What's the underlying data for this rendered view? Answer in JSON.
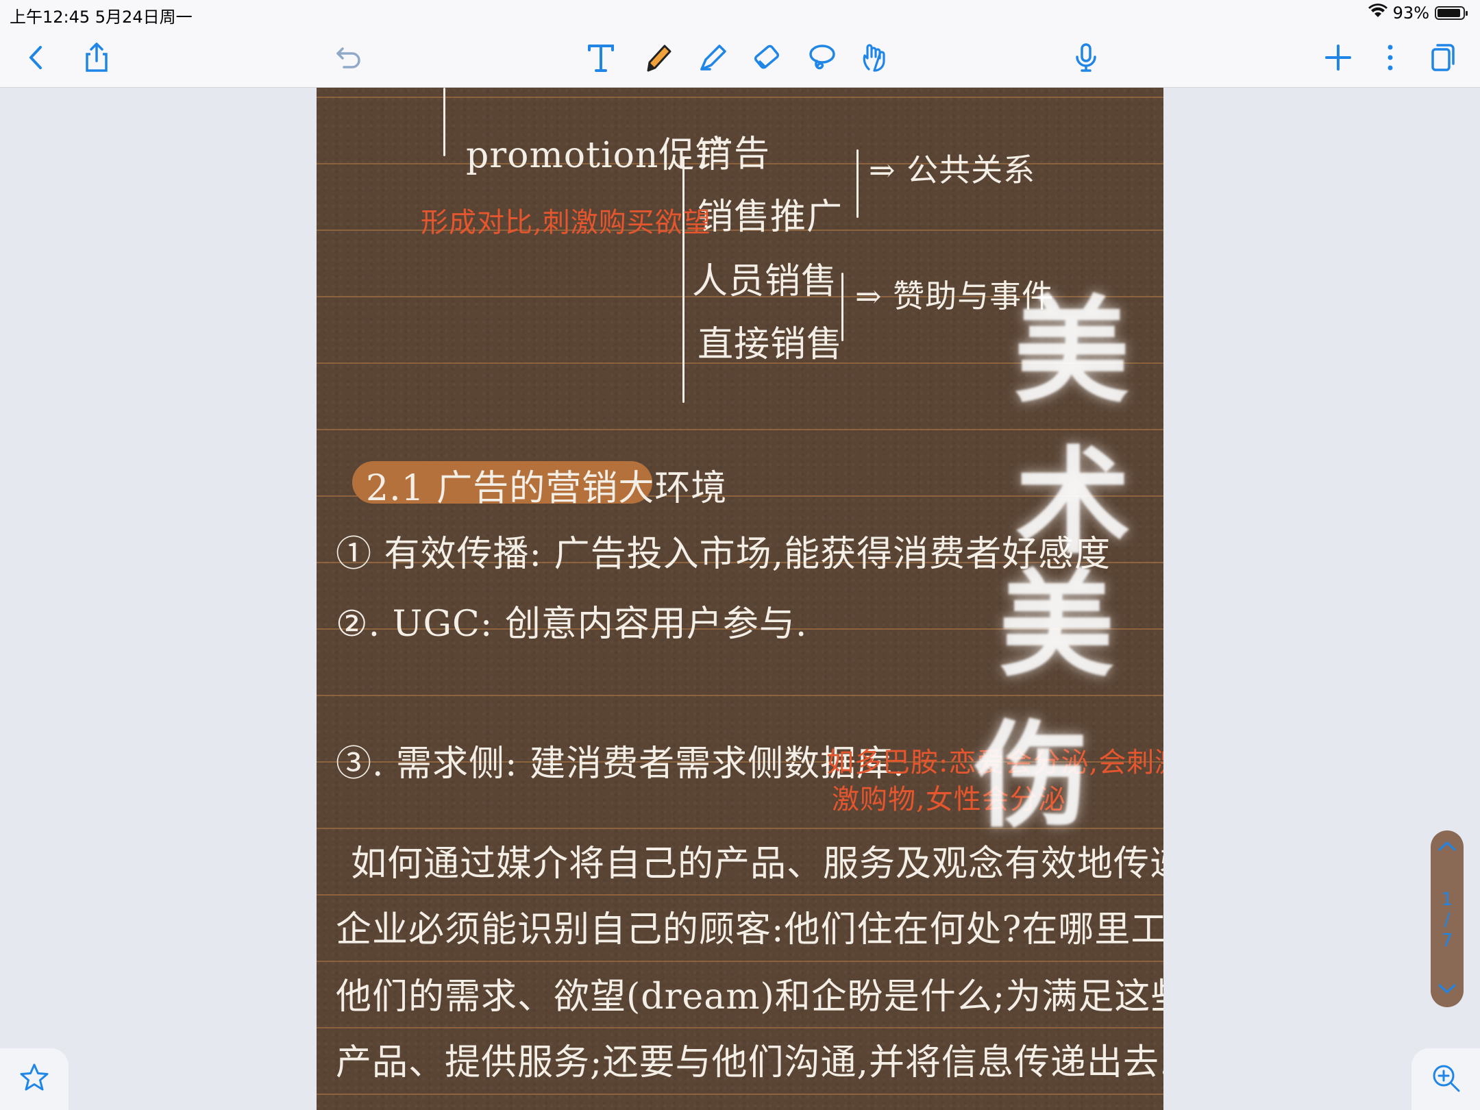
{
  "status_bar": {
    "time": "上午12:45   5月24日周一",
    "battery": "93%",
    "battery_level": 0.93
  },
  "toolbar": {
    "icons": [
      "back-icon",
      "share-icon",
      "undo-icon",
      "text-tool-icon",
      "pen-icon",
      "highlighter-icon",
      "eraser-icon",
      "lasso-icon",
      "hand-icon",
      "microphone-icon",
      "plus-icon",
      "more-icon",
      "pages-icon"
    ]
  },
  "note": {
    "promotion_label": "promotion促销",
    "promo_items": [
      "广告",
      "销售推广",
      "人员销售",
      "直接销售"
    ],
    "promo_note": "形成对比,刺激购买欲望",
    "pr_note": "⇒ 公共关系",
    "sponsor_note": "⇒ 赞助与事件",
    "section_heading": "2.1 广告的营销大环境",
    "point1": "① 有效传播: 广告投入市场,能获得消费者好感度",
    "point2": "②. UGC: 创意内容用户参与.",
    "point3": "③. 需求侧: 建消费者需求侧数据库.",
    "point3_note_line1": "如多巴胺:恋爱会分泌,会刺激,刺",
    "point3_note_line2": "激购物,女性会分泌",
    "paragraph": [
      "如何通过媒介将自己的产品、服务及观念有效地传递给消费者?",
      "企业必须能识别自己的顾客:他们住在何处?在哪里工作?如何休闲?",
      "他们的需求、欲望(dream)和企盼是什么;为满足这些欲望而制造",
      "产品、提供服务;还要与他们沟通,并将信息传递出去."
    ],
    "watermark_chars": [
      "美",
      "术",
      "美",
      "伤"
    ]
  },
  "page_nav": {
    "current": "1",
    "separator": "/",
    "total": "7"
  },
  "colors": {
    "page_bg": "#5a4535",
    "ink_white": "#f4efe6",
    "ink_red": "#e5562e",
    "highlight": "#b5713c",
    "accent_blue": "#1f86e8"
  }
}
